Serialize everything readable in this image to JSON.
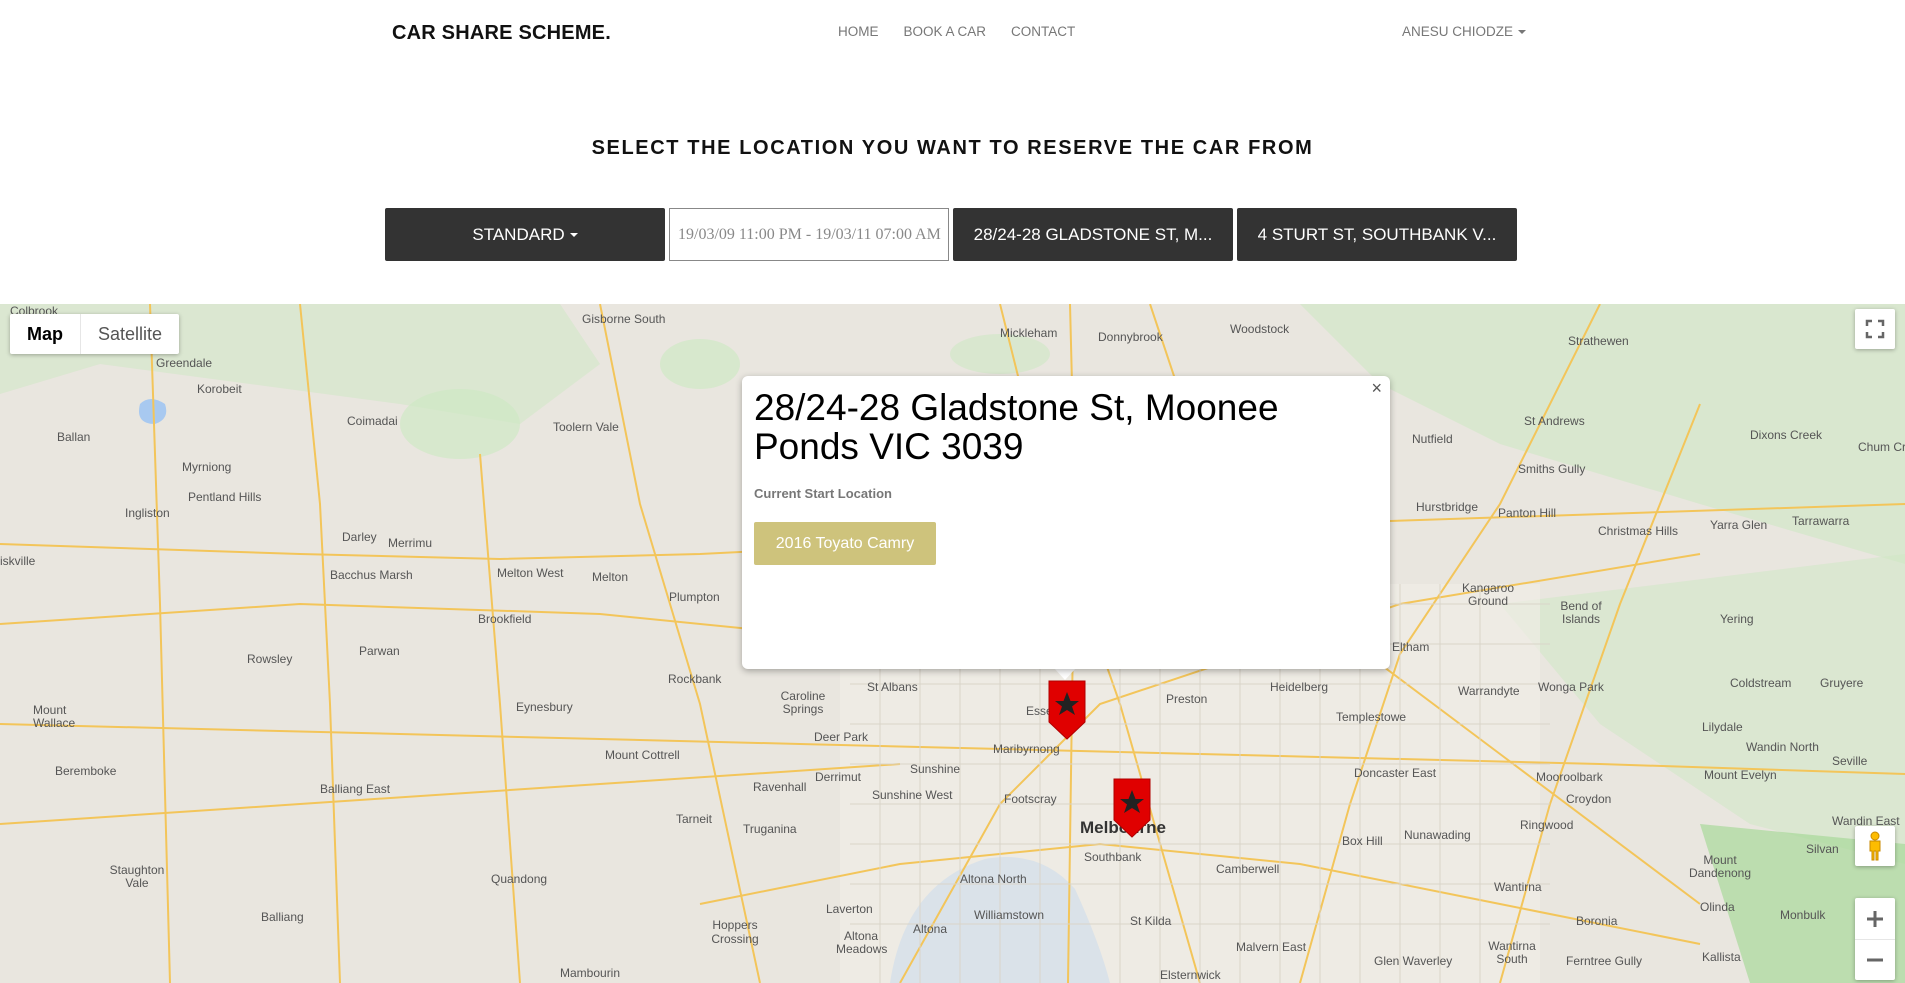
{
  "navbar": {
    "brand": "CAR SHARE SCHEME.",
    "links": [
      "HOME",
      "BOOK A CAR",
      "CONTACT"
    ],
    "user": "ANESU CHIODZE"
  },
  "page_title": "SELECT THE LOCATION YOU WANT TO RESERVE THE CAR FROM",
  "controls": {
    "car_type": "STANDARD",
    "date_range": "19/03/09 11:00 PM - 19/03/11 07:00 AM",
    "start_location": "28/24-28 GLADSTONE ST, M...",
    "end_location": "4 STURT ST, SOUTHBANK V..."
  },
  "map": {
    "type_buttons": {
      "map": "Map",
      "satellite": "Satellite"
    },
    "labels": {
      "colbrook": "Colbrook",
      "gisborne_south": "Gisborne South",
      "mickleham": "Mickleham",
      "donnybrook": "Donnybrook",
      "woodstock": "Woodstock",
      "strathewen": "Strathewen",
      "greendale": "Greendale",
      "korobeit": "Korobeit",
      "coimadai": "Coimadai",
      "toolern_vale": "Toolern Vale",
      "ballan": "Ballan",
      "myrniong": "Myrniong",
      "pentland_hills": "Pentland Hills",
      "ingliston": "Ingliston",
      "darley": "Darley",
      "merrimu": "Merrimu",
      "bacchus_marsh": "Bacchus Marsh",
      "melton_west": "Melton West",
      "melton": "Melton",
      "plumpton": "Plumpton",
      "brookfield": "Brookfield",
      "rowsley": "Rowsley",
      "parwan": "Parwan",
      "rockbank": "Rockbank",
      "mount_wallace": "Mount Wallace",
      "eynesbury": "Eynesbury",
      "beremboke": "Beremboke",
      "balliang_east": "Balliang East",
      "mount_cottrell": "Mount Cottrell",
      "tarneit": "Tarneit",
      "truganina": "Truganina",
      "staughton_vale": "Staughton Vale",
      "quandong": "Quandong",
      "balliang": "Balliang",
      "hoppers_crossing": "Hoppers Crossing",
      "laverton": "Laverton",
      "altona_meadows": "Altona Meadows",
      "altona": "Altona",
      "williamstown": "Williamstown",
      "altona_north": "Altona North",
      "sunshine": "Sunshine",
      "sunshine_west": "Sunshine West",
      "deer_park": "Deer Park",
      "caroline_springs": "Caroline Springs",
      "st_albans": "St Albans",
      "derrimut": "Derrimut",
      "ravenhall": "Ravenhall",
      "maribyrnong": "Maribyrnong",
      "footscray": "Footscray",
      "melbourne": "Melbourne",
      "southbank": "Southbank",
      "st_kilda": "St Kilda",
      "preston": "Preston",
      "heidelberg": "Heidelberg",
      "templestowe": "Templestowe",
      "doncaster_east": "Doncaster East",
      "box_hill": "Box Hill",
      "nunawading": "Nunawading",
      "ringwood": "Ringwood",
      "camberwell": "Camberwell",
      "malvern_east": "Malvern East",
      "glen_waverley": "Glen Waverley",
      "wantirna": "Wantirna",
      "wantirna_south": "Wantirna South",
      "ferntree_gully": "Ferntree Gully",
      "mooroolbark": "Mooroolbark",
      "croydon": "Croydon",
      "warrandyte": "Warrandyte",
      "wonga_park": "Wonga Park",
      "kangaroo_ground": "Kangaroo Ground",
      "bend_of_islands": "Bend of Islands",
      "eltham": "Eltham",
      "hurstbridge": "Hurstbridge",
      "panton_hill": "Panton Hill",
      "christmas_hills": "Christmas Hills",
      "yarra_glen": "Yarra Glen",
      "tarrawarra": "Tarrawarra",
      "smiths_gully": "Smiths Gully",
      "st_andrews": "St Andrews",
      "nutfield": "Nutfield",
      "dixons_creek": "Dixons Creek",
      "chum_creek": "Chum Cre",
      "yering": "Yering",
      "lilydale": "Lilydale",
      "coldstream": "Coldstream",
      "gruyere": "Gruyere",
      "mount_evelyn": "Mount Evelyn",
      "wandin_north": "Wandin North",
      "seville": "Seville",
      "mount_dandenong": "Mount Dandenong",
      "olinda": "Olinda",
      "silvan": "Silvan",
      "boronia": "Boronia",
      "monbulk": "Monbulk",
      "kallista": "Kallista",
      "elsternwick": "Elsternwick",
      "mambourin": "Mambourin",
      "wandin_east": "Wandin East",
      "eiskville": "iskville",
      "essendon": "Esse"
    },
    "popup": {
      "title": "28/24-28 Gladstone St, Moonee Ponds VIC 3039",
      "subtitle": "Current Start Location",
      "car": "2016 Toyato Camry",
      "close": "×"
    }
  },
  "colors": {
    "dark_button": "#333333",
    "car_button": "#cec37c",
    "marker": "#e00000"
  }
}
